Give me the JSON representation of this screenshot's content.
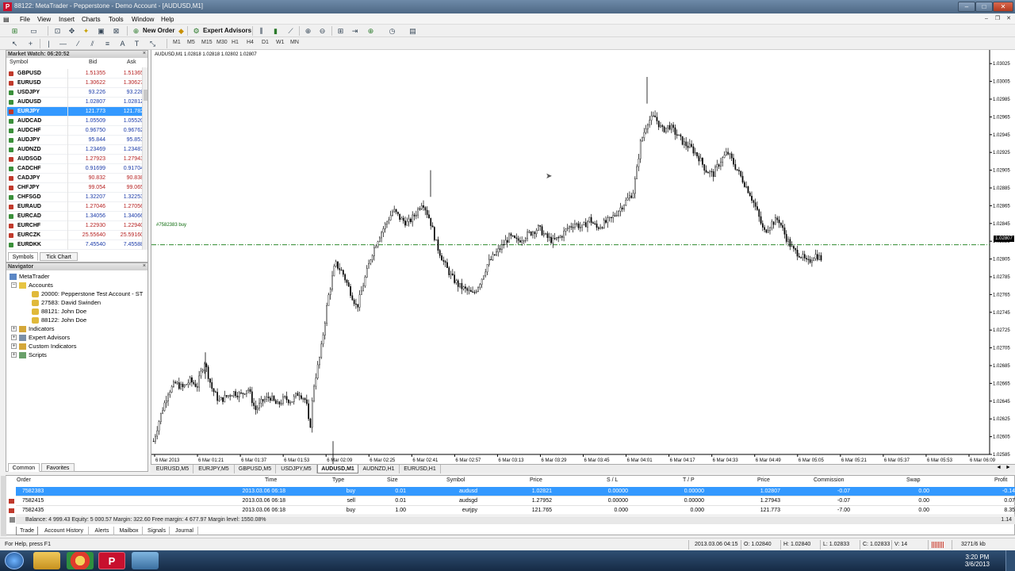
{
  "window": {
    "title": "88122: MetaTrader - Pepperstone - Demo Account - [AUDUSD,M1]",
    "app_icon": "P",
    "min": "–",
    "max": "□",
    "close": "✕"
  },
  "menu": [
    "File",
    "View",
    "Insert",
    "Charts",
    "Tools",
    "Window",
    "Help"
  ],
  "toolbar": {
    "new_order": "New Order",
    "expert_advisors": "Expert Advisors",
    "timeframes": [
      "M1",
      "M5",
      "M15",
      "M30",
      "H1",
      "H4",
      "D1",
      "W1",
      "MN"
    ]
  },
  "market_watch": {
    "title": "Market Watch: 06:20:52",
    "headers": {
      "symbol": "Symbol",
      "bid": "Bid",
      "ask": "Ask"
    },
    "rows": [
      {
        "symbol": "GBPUSD",
        "bid": "1.51355",
        "ask": "1.51365",
        "dir": "down"
      },
      {
        "symbol": "EURUSD",
        "bid": "1.30622",
        "ask": "1.30627",
        "dir": "down"
      },
      {
        "symbol": "USDJPY",
        "bid": "93.226",
        "ask": "93.228",
        "dir": "up"
      },
      {
        "symbol": "AUDUSD",
        "bid": "1.02807",
        "ask": "1.02812",
        "dir": "up"
      },
      {
        "symbol": "EURJPY",
        "bid": "121.773",
        "ask": "121.782",
        "dir": "down",
        "selected": true
      },
      {
        "symbol": "AUDCAD",
        "bid": "1.05509",
        "ask": "1.05520",
        "dir": "up"
      },
      {
        "symbol": "AUDCHF",
        "bid": "0.96750",
        "ask": "0.96762",
        "dir": "up"
      },
      {
        "symbol": "AUDJPY",
        "bid": "95.844",
        "ask": "95.851",
        "dir": "up"
      },
      {
        "symbol": "AUDNZD",
        "bid": "1.23469",
        "ask": "1.23487",
        "dir": "up"
      },
      {
        "symbol": "AUDSGD",
        "bid": "1.27923",
        "ask": "1.27943",
        "dir": "down"
      },
      {
        "symbol": "CADCHF",
        "bid": "0.91699",
        "ask": "0.91704",
        "dir": "up"
      },
      {
        "symbol": "CADJPY",
        "bid": "90.832",
        "ask": "90.838",
        "dir": "down"
      },
      {
        "symbol": "CHFJPY",
        "bid": "99.054",
        "ask": "99.065",
        "dir": "down"
      },
      {
        "symbol": "CHFSGD",
        "bid": "1.32207",
        "ask": "1.32253",
        "dir": "up"
      },
      {
        "symbol": "EURAUD",
        "bid": "1.27046",
        "ask": "1.27056",
        "dir": "down"
      },
      {
        "symbol": "EURCAD",
        "bid": "1.34056",
        "ask": "1.34066",
        "dir": "up"
      },
      {
        "symbol": "EURCHF",
        "bid": "1.22930",
        "ask": "1.22940",
        "dir": "down"
      },
      {
        "symbol": "EURCZK",
        "bid": "25.55640",
        "ask": "25.59160",
        "dir": "down"
      },
      {
        "symbol": "EURDKK",
        "bid": "7.45540",
        "ask": "7.45588",
        "dir": "up"
      }
    ],
    "tabs": [
      "Symbols",
      "Tick Chart"
    ],
    "colors": {
      "up": "#3a8f3a",
      "down": "#c0392b",
      "bid_up": "#1a3aa8",
      "bid_down": "#b51f1f"
    }
  },
  "navigator": {
    "title": "Navigator",
    "root": "MetaTrader",
    "accounts_label": "Accounts",
    "accounts": [
      "20000: Pepperstone Test Account - ST",
      "27583: David Swinden",
      "88121: John Doe",
      "88122: John Doe"
    ],
    "nodes": [
      "Indicators",
      "Expert Advisors",
      "Custom Indicators",
      "Scripts"
    ],
    "tabs": [
      "Common",
      "Favorites"
    ]
  },
  "chart": {
    "header": "AUDUSD,M1  1.02818 1.02818 1.02802 1.02807",
    "order_label": "#7582383 buy",
    "current_price": "1.02807",
    "tabs": [
      "EURUSD,M5",
      "EURJPY,M5",
      "GBPUSD,M5",
      "USDJPY,M5",
      "AUDUSD,M1",
      "AUDNZD,H1",
      "EURUSD,H1"
    ],
    "active_tab": 4,
    "nav_arrows": [
      "◄",
      "►"
    ]
  },
  "chart_data": {
    "type": "candlestick",
    "symbol": "AUDUSD",
    "timeframe": "M1",
    "y_ticks": [
      "1.03025",
      "1.03005",
      "1.02985",
      "1.02965",
      "1.02945",
      "1.02925",
      "1.02905",
      "1.02885",
      "1.02865",
      "1.02845",
      "1.02825",
      "1.02805",
      "1.02785",
      "1.02765",
      "1.02745",
      "1.02725",
      "1.02705",
      "1.02685",
      "1.02665",
      "1.02645",
      "1.02625",
      "1.02605",
      "1.02585"
    ],
    "ylim": [
      1.02585,
      1.03035
    ],
    "x_ticks": [
      "6 Mar 2013",
      "6 Mar 01:21",
      "6 Mar 01:37",
      "6 Mar 01:53",
      "6 Mar 02:09",
      "6 Mar 02:25",
      "6 Mar 02:41",
      "6 Mar 02:57",
      "6 Mar 03:13",
      "6 Mar 03:29",
      "6 Mar 03:45",
      "6 Mar 04:01",
      "6 Mar 04:17",
      "6 Mar 04:33",
      "6 Mar 04:49",
      "6 Mar 05:05",
      "6 Mar 05:21",
      "6 Mar 05:37",
      "6 Mar 05:53",
      "6 Mar 06:09"
    ],
    "order_line": 1.02821,
    "last": 1.02807,
    "path": [
      [
        0,
        1.026
      ],
      [
        4,
        1.0263
      ],
      [
        8,
        1.02655
      ],
      [
        12,
        1.02665
      ],
      [
        16,
        1.0266
      ],
      [
        20,
        1.02668
      ],
      [
        24,
        1.02662
      ],
      [
        28,
        1.0269
      ],
      [
        32,
        1.0266
      ],
      [
        36,
        1.02645
      ],
      [
        40,
        1.0265
      ],
      [
        44,
        1.02655
      ],
      [
        48,
        1.02652
      ],
      [
        52,
        1.0266
      ],
      [
        56,
        1.02635
      ],
      [
        60,
        1.02645
      ],
      [
        64,
        1.0265
      ],
      [
        68,
        1.0264
      ],
      [
        72,
        1.02648
      ],
      [
        76,
        1.02645
      ],
      [
        80,
        1.02655
      ],
      [
        84,
        1.02645
      ],
      [
        86,
        1.0261
      ],
      [
        88,
        1.0266
      ],
      [
        92,
        1.027
      ],
      [
        96,
        1.0276
      ],
      [
        100,
        1.028
      ],
      [
        104,
        1.0279
      ],
      [
        108,
        1.0277
      ],
      [
        112,
        1.0275
      ],
      [
        116,
        1.0278
      ],
      [
        120,
        1.0281
      ],
      [
        124,
        1.0283
      ],
      [
        128,
        1.02845
      ],
      [
        132,
        1.0286
      ],
      [
        136,
        1.0285
      ],
      [
        140,
        1.02845
      ],
      [
        144,
        1.02855
      ],
      [
        148,
        1.0287
      ],
      [
        150,
        1.0286
      ],
      [
        152,
        1.0285
      ],
      [
        156,
        1.0282
      ],
      [
        160,
        1.028
      ],
      [
        164,
        1.02785
      ],
      [
        168,
        1.02775
      ],
      [
        172,
        1.0277
      ],
      [
        176,
        1.02765
      ],
      [
        180,
        1.0278
      ],
      [
        184,
        1.028
      ],
      [
        188,
        1.0281
      ],
      [
        192,
        1.0282
      ],
      [
        196,
        1.0283
      ],
      [
        200,
        1.02825
      ],
      [
        204,
        1.0283
      ],
      [
        208,
        1.02835
      ],
      [
        212,
        1.0284
      ],
      [
        216,
        1.0283
      ],
      [
        220,
        1.02825
      ],
      [
        224,
        1.0283
      ],
      [
        228,
        1.0284
      ],
      [
        232,
        1.02845
      ],
      [
        236,
        1.0284
      ],
      [
        240,
        1.0285
      ],
      [
        244,
        1.0284
      ],
      [
        248,
        1.02845
      ],
      [
        252,
        1.0285
      ],
      [
        256,
        1.0286
      ],
      [
        260,
        1.0287
      ],
      [
        264,
        1.0288
      ],
      [
        266,
        1.02905
      ],
      [
        268,
        1.02935
      ],
      [
        272,
        1.0296
      ],
      [
        276,
        1.02965
      ],
      [
        280,
        1.0295
      ],
      [
        284,
        1.02955
      ],
      [
        288,
        1.02945
      ],
      [
        292,
        1.02935
      ],
      [
        296,
        1.0293
      ],
      [
        300,
        1.0292
      ],
      [
        304,
        1.02905
      ],
      [
        308,
        1.029
      ],
      [
        312,
        1.02915
      ],
      [
        316,
        1.02925
      ],
      [
        320,
        1.0291
      ],
      [
        324,
        1.02895
      ],
      [
        328,
        1.0288
      ],
      [
        332,
        1.0286
      ],
      [
        336,
        1.02835
      ],
      [
        340,
        1.02845
      ],
      [
        344,
        1.0285
      ],
      [
        348,
        1.0283
      ],
      [
        352,
        1.02815
      ],
      [
        356,
        1.0281
      ],
      [
        360,
        1.028
      ],
      [
        364,
        1.0281
      ],
      [
        368,
        1.02805
      ]
    ]
  },
  "terminal": {
    "headers": [
      "Order",
      "Time",
      "Type",
      "Size",
      "Symbol",
      "Price",
      "S / L",
      "T / P",
      "Price",
      "Commission",
      "Swap",
      "Profit"
    ],
    "rows": [
      {
        "order": "7582383",
        "time": "2013.03.06 06:18",
        "type": "buy",
        "size": "0.01",
        "symbol": "audusd",
        "price": "1.02821",
        "sl": "0.00000",
        "tp": "0.00000",
        "cur": "1.02807",
        "commission": "-0.07",
        "swap": "0.00",
        "profit": "-0.14",
        "selected": true
      },
      {
        "order": "7582415",
        "time": "2013.03.06 06:18",
        "type": "sell",
        "size": "0.01",
        "symbol": "audsgd",
        "price": "1.27952",
        "sl": "0.00000",
        "tp": "0.00000",
        "cur": "1.27943",
        "commission": "-0.07",
        "swap": "0.00",
        "profit": "0.07"
      },
      {
        "order": "7582435",
        "time": "2013.03.06 06:18",
        "type": "buy",
        "size": "1.00",
        "symbol": "eurjpy",
        "price": "121.765",
        "sl": "0.000",
        "tp": "0.000",
        "cur": "121.773",
        "commission": "-7.00",
        "swap": "0.00",
        "profit": "8.35"
      }
    ],
    "balance": "Balance: 4 999.43  Equity: 5 000.57  Margin: 322.60  Free margin: 4 677.97  Margin level: 1550.08%",
    "total": "1.14",
    "tabs": [
      "Trade",
      "Account History",
      "Alerts",
      "Mailbox",
      "Signals",
      "Journal"
    ]
  },
  "statusbar": {
    "help": "For Help, press F1",
    "datetime": "2013.03.06 04:15",
    "open": "O: 1.02840",
    "high": "H: 1.02840",
    "low": "L: 1.02833",
    "close": "C: 1.02833",
    "volume": "V: 14",
    "traffic": "3271/6 kb"
  },
  "taskbar": {
    "time": "3:20 PM",
    "date": "3/6/2013"
  }
}
